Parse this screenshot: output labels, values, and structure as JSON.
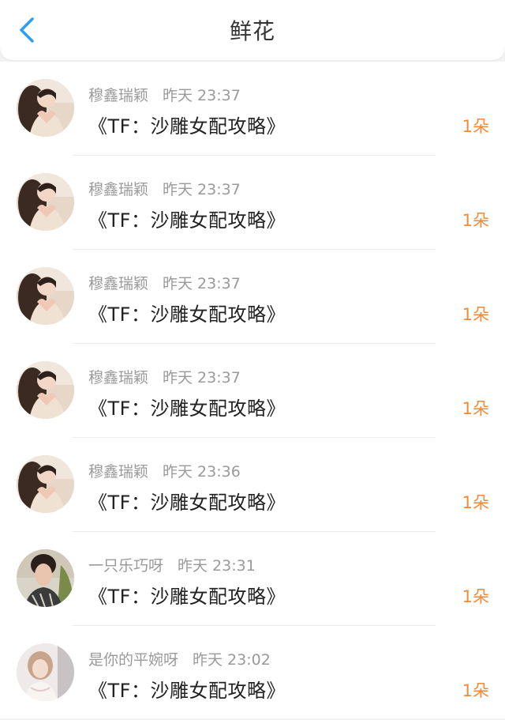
{
  "header": {
    "title": "鲜花",
    "back_icon": "chevron-left-icon"
  },
  "colors": {
    "accent": "#2a9df4",
    "amount": "#f28a3a",
    "meta": "#9a9a9a"
  },
  "items": [
    {
      "user": "穆鑫瑞颖",
      "time": "昨天 23:37",
      "book": "《TF：沙雕女配攻略》",
      "amount": "1朵"
    },
    {
      "user": "穆鑫瑞颖",
      "time": "昨天 23:37",
      "book": "《TF：沙雕女配攻略》",
      "amount": "1朵"
    },
    {
      "user": "穆鑫瑞颖",
      "time": "昨天 23:37",
      "book": "《TF：沙雕女配攻略》",
      "amount": "1朵"
    },
    {
      "user": "穆鑫瑞颖",
      "time": "昨天 23:37",
      "book": "《TF：沙雕女配攻略》",
      "amount": "1朵"
    },
    {
      "user": "穆鑫瑞颖",
      "time": "昨天 23:36",
      "book": "《TF：沙雕女配攻略》",
      "amount": "1朵"
    },
    {
      "user": "一只乐巧呀",
      "time": "昨天 23:31",
      "book": "《TF：沙雕女配攻略》",
      "amount": "1朵"
    },
    {
      "user": "是你的平婉呀",
      "time": "昨天 23:02",
      "book": "《TF：沙雕女配攻略》",
      "amount": "1朵"
    }
  ]
}
